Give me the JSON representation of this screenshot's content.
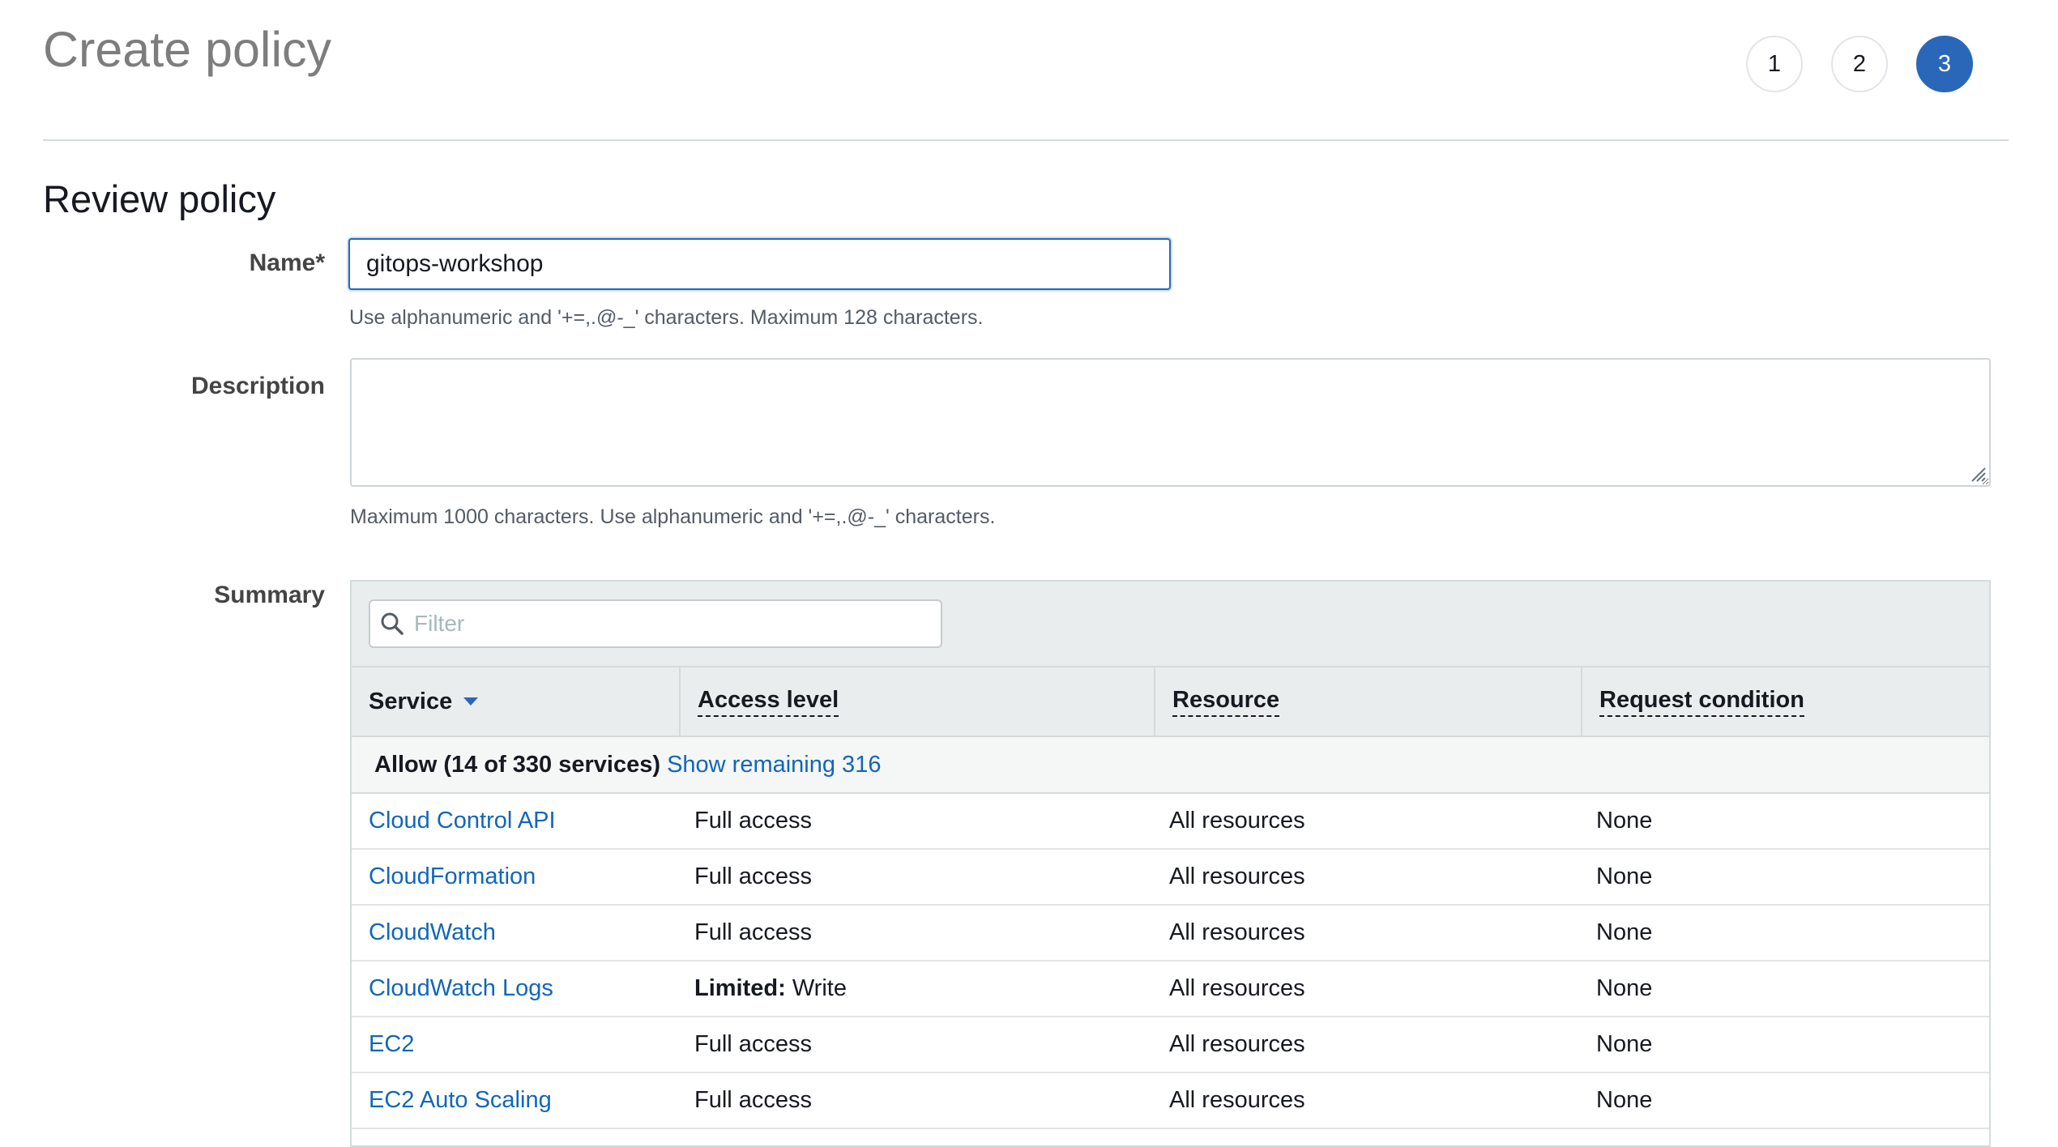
{
  "header": {
    "title": "Create policy",
    "steps": [
      "1",
      "2",
      "3"
    ],
    "active_step": "3"
  },
  "review": {
    "section_title": "Review policy",
    "name": {
      "label": "Name*",
      "value": "gitops-workshop",
      "hint": "Use alphanumeric and '+=,.@-_' characters. Maximum 128 characters."
    },
    "description": {
      "label": "Description",
      "value": "",
      "hint": "Maximum 1000 characters. Use alphanumeric and '+=,.@-_' characters."
    },
    "summary_label": "Summary"
  },
  "summary": {
    "filter_placeholder": "Filter",
    "columns": [
      "Service",
      "Access level",
      "Resource",
      "Request condition"
    ],
    "allow_text": "Allow (14 of 330 services)",
    "show_remaining": "Show remaining 316",
    "rows": [
      {
        "service": "Cloud Control API",
        "access_prefix": "",
        "access": "Full access",
        "resource": "All resources",
        "condition": "None"
      },
      {
        "service": "CloudFormation",
        "access_prefix": "",
        "access": "Full access",
        "resource": "All resources",
        "condition": "None"
      },
      {
        "service": "CloudWatch",
        "access_prefix": "",
        "access": "Full access",
        "resource": "All resources",
        "condition": "None"
      },
      {
        "service": "CloudWatch Logs",
        "access_prefix": "Limited:",
        "access": " Write",
        "resource": "All resources",
        "condition": "None"
      },
      {
        "service": "EC2",
        "access_prefix": "",
        "access": "Full access",
        "resource": "All resources",
        "condition": "None"
      },
      {
        "service": "EC2 Auto Scaling",
        "access_prefix": "",
        "access": "Full access",
        "resource": "All resources",
        "condition": "None"
      }
    ]
  },
  "colors": {
    "accent": "#2a67b9",
    "link": "#1166bb"
  },
  "icons": {
    "filter": "search-icon",
    "sort": "caret-down-icon",
    "resize": "resize-grip-icon"
  }
}
